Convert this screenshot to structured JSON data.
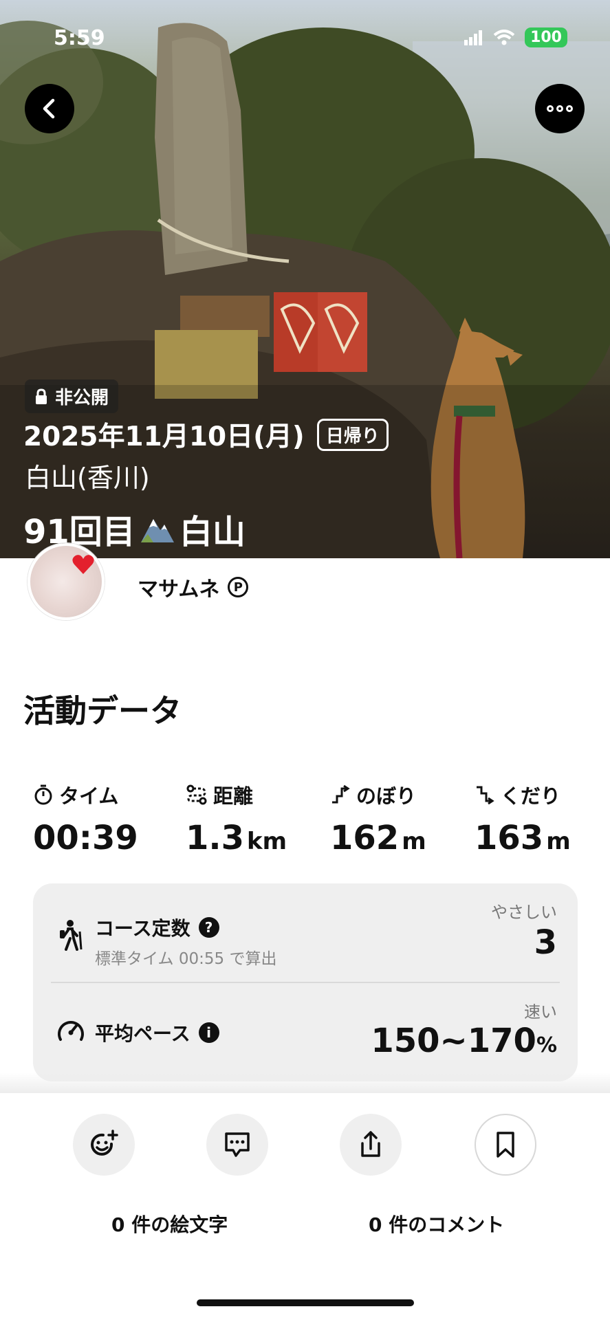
{
  "status_bar": {
    "time": "5:59",
    "battery": "100"
  },
  "hero": {
    "visibility_badge": "非公開",
    "date": "2025年11月10日(月)",
    "trip_type": "日帰り",
    "mountain": "白山(香川)",
    "title_prefix": "91回目",
    "title_suffix": "白山"
  },
  "user": {
    "name": "マサムネ",
    "badge": "P"
  },
  "activity": {
    "section_title": "活動データ",
    "stats": [
      {
        "label": "タイム",
        "value": "00:39",
        "unit": "",
        "icon": "stopwatch-icon"
      },
      {
        "label": "距離",
        "value": "1.3",
        "unit": "km",
        "icon": "route-icon"
      },
      {
        "label": "のぼり",
        "value": "162",
        "unit": "m",
        "icon": "ascent-icon"
      },
      {
        "label": "くだり",
        "value": "163",
        "unit": "m",
        "icon": "descent-icon"
      }
    ],
    "course_constant": {
      "title": "コース定数",
      "sub": "標準タイム 00:55 で算出",
      "rating": "やさしい",
      "value": "3"
    },
    "avg_pace": {
      "title": "平均ペース",
      "rating": "速い",
      "value": "150~170",
      "unit": "%"
    }
  },
  "actions": {
    "emoji_count": "0 件の絵文字",
    "comment_count": "0 件のコメント"
  }
}
